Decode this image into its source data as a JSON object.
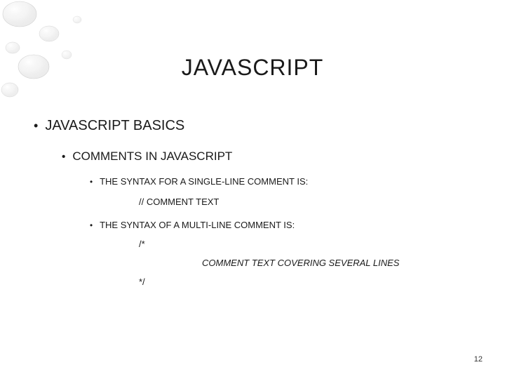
{
  "title": "JAVASCRIPT",
  "bullets": {
    "l1": "JAVASCRIPT BASICS",
    "l2": "COMMENTS IN JAVASCRIPT",
    "l3a": "THE SYNTAX FOR A SINGLE-LINE COMMENT IS:",
    "code_single": "// COMMENT TEXT",
    "l3b": "THE SYNTAX OF A MULTI-LINE COMMENT IS:",
    "multi_open": "/*",
    "multi_body": "COMMENT TEXT COVERING SEVERAL LINES",
    "multi_close": "*/"
  },
  "page_number": "12"
}
